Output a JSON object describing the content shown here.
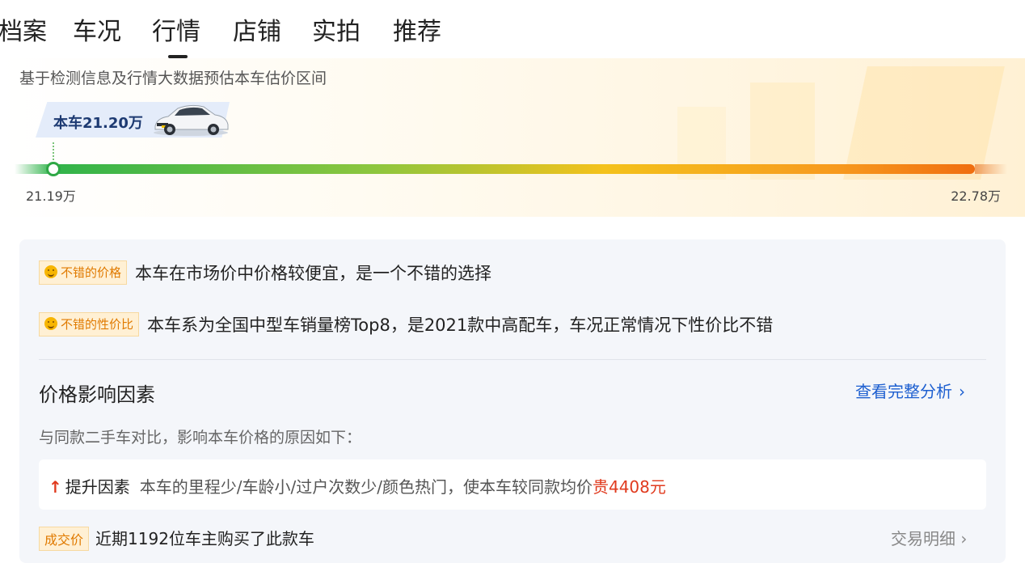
{
  "tabs": [
    {
      "label": "档案"
    },
    {
      "label": "车况"
    },
    {
      "label": "行情"
    },
    {
      "label": "店铺"
    },
    {
      "label": "实拍"
    },
    {
      "label": "推荐"
    }
  ],
  "active_tab": "行情",
  "price_estimate": {
    "subtitle": "基于检测信息及行情大数据预估本车估价区间",
    "this_car_price": "本车21.20万",
    "range_min": "21.19万",
    "range_max": "22.78万"
  },
  "highlights": [
    {
      "tag": "不错的价格",
      "desc": "本车在市场价中价格较便宜，是一个不错的选择",
      "icon": "smile-icon"
    },
    {
      "tag": "不错的性价比",
      "desc": "本车系为全国中型车销量榜Top8，是2021款中高配车，车况正常情况下性价比不错",
      "icon": "smile-icon"
    }
  ],
  "factors": {
    "title": "价格影响因素",
    "link_label": "查看完整分析",
    "link_chevron": "›",
    "subtitle": "与同款二手车对比，影响本车价格的原因如下：",
    "up_factor": {
      "icon": "↑",
      "label": "提升因素",
      "desc": "本车的里程少/车龄小/过户次数少/颜色热门",
      "amount_label": "，使本车较同款均价",
      "amount": "贵4408元"
    }
  },
  "deal": {
    "tag": "成交价",
    "text": "近期1192位车主购买了此款车",
    "link_label": "交易明细 ›"
  },
  "colors": {
    "accent_blue": "#1d5fd0",
    "price_up_red": "#e03a1e",
    "tag_orange": "#e07a00",
    "bar_start_green": "#2fb34a",
    "bar_end_orange": "#f06e10"
  }
}
